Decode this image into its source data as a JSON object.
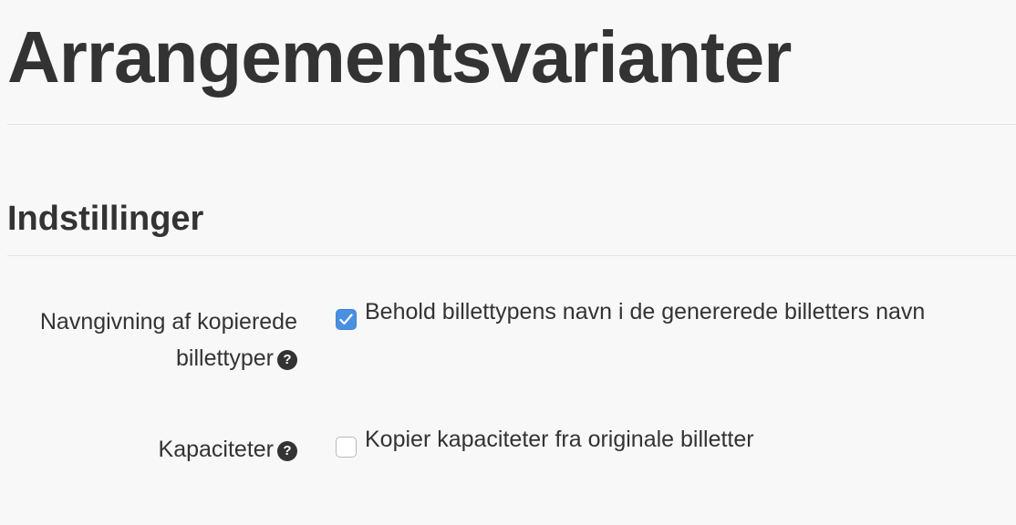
{
  "page": {
    "title": "Arrangementsvarianter"
  },
  "settings": {
    "heading": "Indstillinger",
    "fields": [
      {
        "label": "Navngivning af kopierede billettyper",
        "help_icon": "question-circle-icon",
        "checkbox_label": "Behold billettypens navn i de genererede billetters navn",
        "checked": true
      },
      {
        "label": "Kapaciteter",
        "help_icon": "question-circle-icon",
        "checkbox_label": "Kopier kapaciteter fra originale billetter",
        "checked": false
      }
    ]
  },
  "colors": {
    "checkbox_checked": "#4a90e2",
    "text": "#333333",
    "background": "#f8f8f8"
  }
}
